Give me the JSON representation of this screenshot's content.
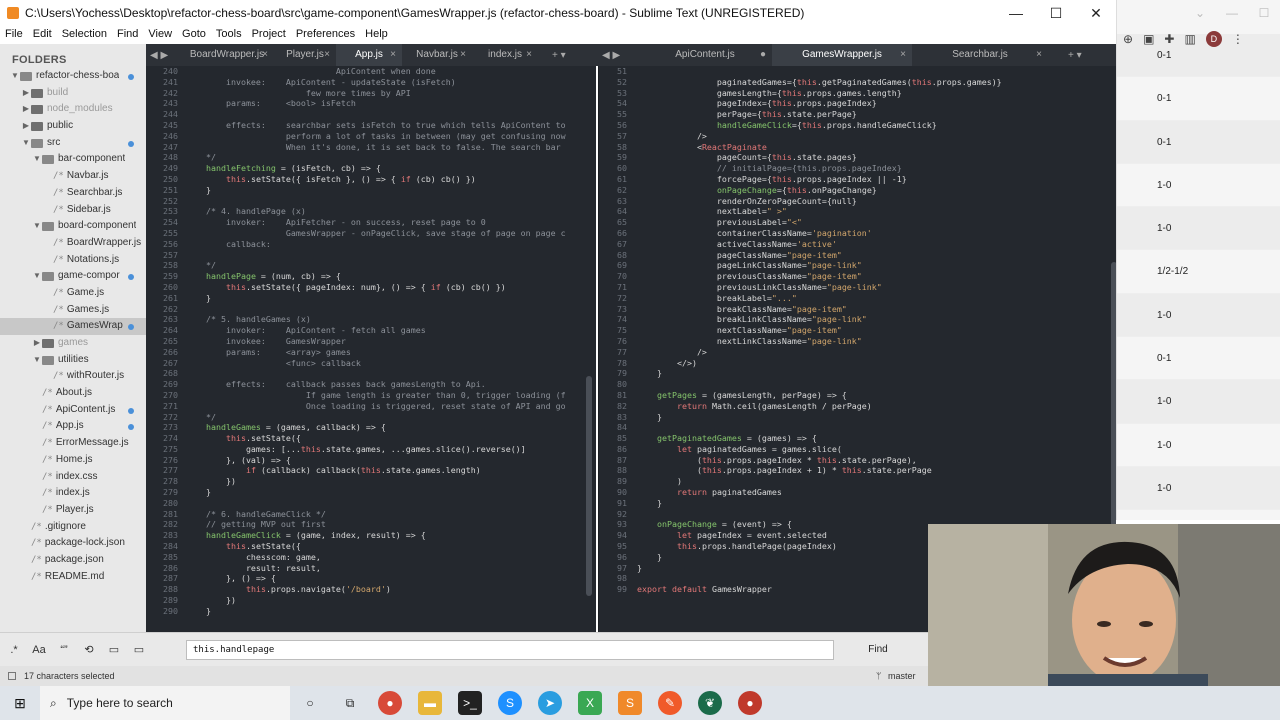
{
  "window": {
    "title": "C:\\Users\\Yochess\\Desktop\\refactor-chess-board\\src\\game-component\\GamesWrapper.js (refactor-chess-board) - Sublime Text (UNREGISTERED)",
    "minimize": "—",
    "maximize": "☐",
    "close": "✕"
  },
  "menu": [
    "File",
    "Edit",
    "Selection",
    "Find",
    "View",
    "Goto",
    "Tools",
    "Project",
    "Preferences",
    "Help"
  ],
  "sidebar": {
    "heading": "FOLDERS",
    "items": [
      {
        "label": "refactor-chess-boa",
        "depth": 0,
        "type": "folder-open",
        "dot": true
      },
      {
        "label": "build",
        "depth": 1,
        "type": "folder",
        "muted": true
      },
      {
        "label": "node_modules",
        "depth": 1,
        "type": "folder",
        "muted": true
      },
      {
        "label": "public",
        "depth": 1,
        "type": "folder"
      },
      {
        "label": "src",
        "depth": 1,
        "type": "folder-open",
        "dot": true
      },
      {
        "label": "bar-component",
        "depth": 2,
        "type": "folder-open"
      },
      {
        "label": "Navbar.js",
        "depth": 3,
        "type": "file"
      },
      {
        "label": "Searchbar.js",
        "depth": 3,
        "type": "file"
      },
      {
        "label": "Sidebar.js",
        "depth": 3,
        "type": "file"
      },
      {
        "label": "board-component",
        "depth": 2,
        "type": "folder-open"
      },
      {
        "label": "BoardWrapper.js",
        "depth": 3,
        "type": "file"
      },
      {
        "label": "Notations.js",
        "depth": 3,
        "type": "file"
      },
      {
        "label": "game-compor",
        "depth": 2,
        "type": "folder-open",
        "dot": true
      },
      {
        "label": "Game.js",
        "depth": 3,
        "type": "file"
      },
      {
        "label": "Games.js",
        "depth": 3,
        "type": "file"
      },
      {
        "label": "GamesWrap",
        "depth": 3,
        "type": "file",
        "selected": true,
        "dot": true
      },
      {
        "label": "games",
        "depth": 2,
        "type": "folder",
        "muted": true
      },
      {
        "label": "utilities",
        "depth": 2,
        "type": "folder-open"
      },
      {
        "label": "withRouter.js",
        "depth": 3,
        "type": "file"
      },
      {
        "label": "About.js",
        "depth": 2,
        "type": "file"
      },
      {
        "label": "ApiContent.js",
        "depth": 2,
        "type": "file",
        "dot": true
      },
      {
        "label": "App.js",
        "depth": 2,
        "type": "file",
        "dot": true
      },
      {
        "label": "ErrorMessage.js",
        "depth": 2,
        "type": "file"
      },
      {
        "label": "Home.js",
        "depth": 2,
        "type": "file"
      },
      {
        "label": "index.css",
        "depth": 2,
        "type": "file"
      },
      {
        "label": "index.js",
        "depth": 2,
        "type": "file"
      },
      {
        "label": "Player.js",
        "depth": 2,
        "type": "file"
      },
      {
        "label": ".gitignore",
        "depth": 1,
        "type": "file"
      },
      {
        "label": "package-lock.json",
        "depth": 1,
        "type": "file"
      },
      {
        "label": "package.json",
        "depth": 1,
        "type": "file"
      },
      {
        "label": "README.md",
        "depth": 1,
        "type": "file"
      }
    ]
  },
  "left_tabs": [
    "BoardWrapper.js",
    "Player.js",
    "App.js",
    "Navbar.js",
    "index.js"
  ],
  "right_tabs": [
    "ApiContent.js",
    "GamesWrapper.js",
    "Searchbar.js"
  ],
  "left_code": {
    "start": 240,
    "lines": [
      "                              ApiContent when done",
      "        invokee:    ApiContent - updateState (isFetch)",
      "                        few more times by API",
      "        params:     <bool> isFetch",
      "",
      "        effects:    searchbar sets isFetch to true which tells ApiContent to",
      "                    perform a lot of tasks in between (may get confusing now",
      "                    When it's done, it is set back to false. The search bar",
      "    */",
      "    handleFetching = (isFetch, cb) => {",
      "        this.setState({ isFetch }, () => { if (cb) cb() })",
      "    }",
      "",
      "    /* 4. handlePage (x)",
      "        invoker:    ApiFetcher - on success, reset page to 0",
      "                    GamesWrapper - onPageClick, save stage of page on page c",
      "        callback:",
      "",
      "    */",
      "    handlePage = (num, cb) => {",
      "        this.setState({ pageIndex: num}, () => { if (cb) cb() })",
      "    }",
      "",
      "    /* 5. handleGames (x)",
      "        invoker:    ApiContent - fetch all games",
      "        invokee:    GamesWrapper",
      "        params:     <array> games",
      "                    <func> callback",
      "",
      "        effects:    callback passes back gamesLength to Api.",
      "                        If game length is greater than 0, trigger loading (f",
      "                        Once loading is triggered, reset state of API and go",
      "    */",
      "    handleGames = (games, callback) => {",
      "        this.setState({",
      "            games: [...this.state.games, ...games.slice().reverse()]",
      "        }, (val) => {",
      "            if (callback) callback(this.state.games.length)",
      "        })",
      "    }",
      "",
      "    /* 6. handleGameClick */",
      "    // getting MVP out first",
      "    handleGameClick = (game, index, result) => {",
      "        this.setState({",
      "            chesscom: game,",
      "            result: result,",
      "        }, () => {",
      "            this.props.navigate('/board')",
      "        })",
      "    }"
    ]
  },
  "right_code": {
    "start": 51,
    "lines": [
      "",
      "                paginatedGames={this.getPaginatedGames(this.props.games)}",
      "                gamesLength={this.props.games.length}",
      "                pageIndex={this.props.pageIndex}",
      "                perPage={this.state.perPage}",
      "                handleGameClick={this.props.handleGameClick}",
      "            />",
      "            <ReactPaginate",
      "                pageCount={this.state.pages}",
      "                // initialPage={this.props.pageIndex}",
      "                forcePage={this.props.pageIndex || -1}",
      "                onPageChange={this.onPageChange}",
      "                renderOnZeroPageCount={null}",
      "                nextLabel=\" >\"",
      "                previousLabel=\"<\"",
      "                containerClassName='pagination'",
      "                activeClassName='active'",
      "                pageClassName=\"page-item\"",
      "                pageLinkClassName=\"page-link\"",
      "                previousClassName=\"page-item\"",
      "                previousLinkClassName=\"page-link\"",
      "                breakLabel=\"...\"",
      "                breakClassName=\"page-item\"",
      "                breakLinkClassName=\"page-link\"",
      "                nextClassName=\"page-item\"",
      "                nextLinkClassName=\"page-link\"",
      "            />",
      "        </>)",
      "    }",
      "",
      "    getPages = (gamesLength, perPage) => {",
      "        return Math.ceil(gamesLength / perPage)",
      "    }",
      "",
      "    getPaginatedGames = (games) => {",
      "        let paginatedGames = games.slice(",
      "            (this.props.pageIndex * this.state.perPage),",
      "            (this.props.pageIndex + 1) * this.state.perPage",
      "        )",
      "        return paginatedGames",
      "    }",
      "",
      "    onPageChange = (event) => {",
      "        let pageIndex = event.selected",
      "        this.props.handlePage(pageIndex)",
      "    }",
      "}",
      "",
      "export default GamesWrapper"
    ]
  },
  "find": {
    "value": "this.handlepage",
    "button": "Find"
  },
  "status": {
    "left": "17 characters selected",
    "branch": "master"
  },
  "taskbar": {
    "search_placeholder": "Type here to search"
  },
  "browser": {
    "avatar_letter": "D",
    "results": [
      "0-1",
      "0-1",
      "0-1",
      "1-0",
      "1-0",
      "1/2-1/2",
      "1-0",
      "0-1",
      "1-0",
      "1-0",
      "1-0"
    ]
  },
  "colors": {
    "editor_bg": "#24282e",
    "keyword": "#e37878",
    "function": "#85c46c",
    "string": "#d2a66c",
    "comment": "#8c9199"
  }
}
